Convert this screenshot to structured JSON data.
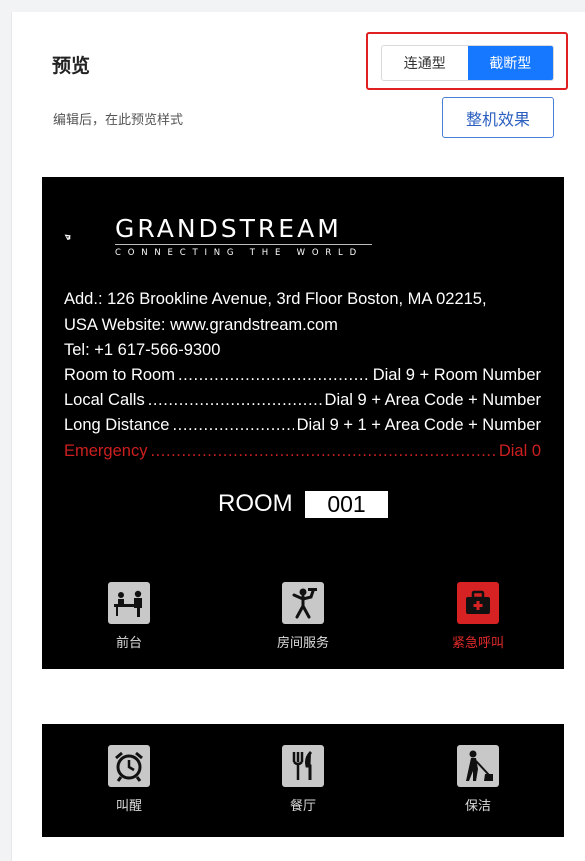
{
  "header": {
    "title": "预览",
    "subtitle": "编辑后，在此预览样式",
    "tabs": [
      {
        "label": "连通型",
        "active": false
      },
      {
        "label": "截断型",
        "active": true
      }
    ],
    "full_preview_label": "整机效果"
  },
  "card": {
    "brand": "GRANDSTREAM",
    "tagline": "CONNECTING THE WORLD",
    "address_line1": "Add.: 126 Brookline Avenue, 3rd Floor Boston, MA 02215,",
    "address_line2": "USA Website: www.grandstream.com",
    "tel": "Tel: +1 617-566-9300",
    "dial_rows": [
      {
        "name": "Room to Room",
        "value": "Dial 9 + Room Number"
      },
      {
        "name": "Local Calls",
        "value": "Dial 9 + Area Code + Number"
      },
      {
        "name": "Long Distance",
        "value": "Dial 9 + 1 + Area Code + Number"
      },
      {
        "name": "Emergency",
        "value": "Dial 0"
      }
    ],
    "room_label": "ROOM",
    "room_number": "001"
  },
  "services_top": [
    {
      "label": "前台",
      "icon": "front-desk-icon"
    },
    {
      "label": "房间服务",
      "icon": "room-service-icon"
    },
    {
      "label": "紧急呼叫",
      "icon": "first-aid-icon"
    }
  ],
  "services_bottom": [
    {
      "label": "叫醒",
      "icon": "alarm-clock-icon"
    },
    {
      "label": "餐厅",
      "icon": "restaurant-icon"
    },
    {
      "label": "保洁",
      "icon": "cleaning-icon"
    }
  ],
  "colors": {
    "accent": "#1677ff",
    "highlight_border": "#e02020",
    "emergency": "#cc1f1f",
    "card_bg": "#000000"
  }
}
